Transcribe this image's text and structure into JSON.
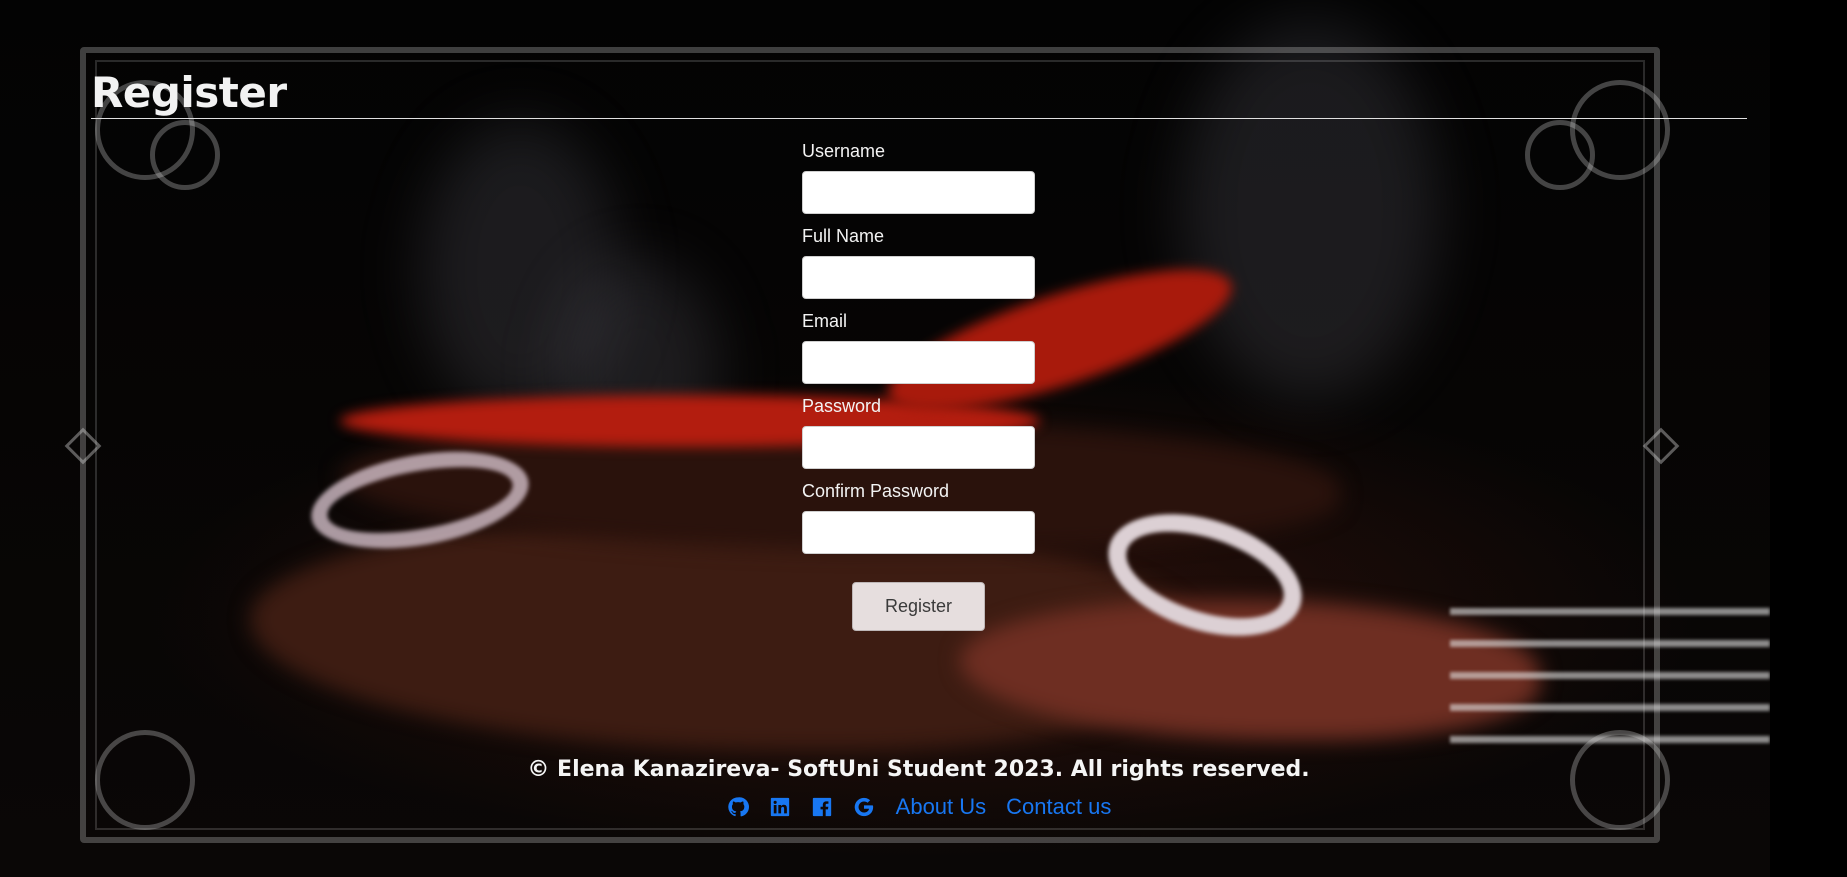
{
  "page": {
    "title": "Register"
  },
  "form": {
    "fields": [
      {
        "label": "Username",
        "value": ""
      },
      {
        "label": "Full Name",
        "value": ""
      },
      {
        "label": "Email",
        "value": ""
      },
      {
        "label": "Password",
        "value": ""
      },
      {
        "label": "Confirm Password",
        "value": ""
      }
    ],
    "submit_label": "Register"
  },
  "footer": {
    "copyright": "© Elena Kanazireva- SoftUni Student 2023. All rights reserved.",
    "icons": [
      "github-icon",
      "linkedin-icon",
      "facebook-icon",
      "google-icon"
    ],
    "links": [
      "About Us",
      "Contact us"
    ]
  },
  "colors": {
    "link": "#1877f2",
    "button_bg": "#e6dede",
    "title": "#f2f2f2"
  }
}
